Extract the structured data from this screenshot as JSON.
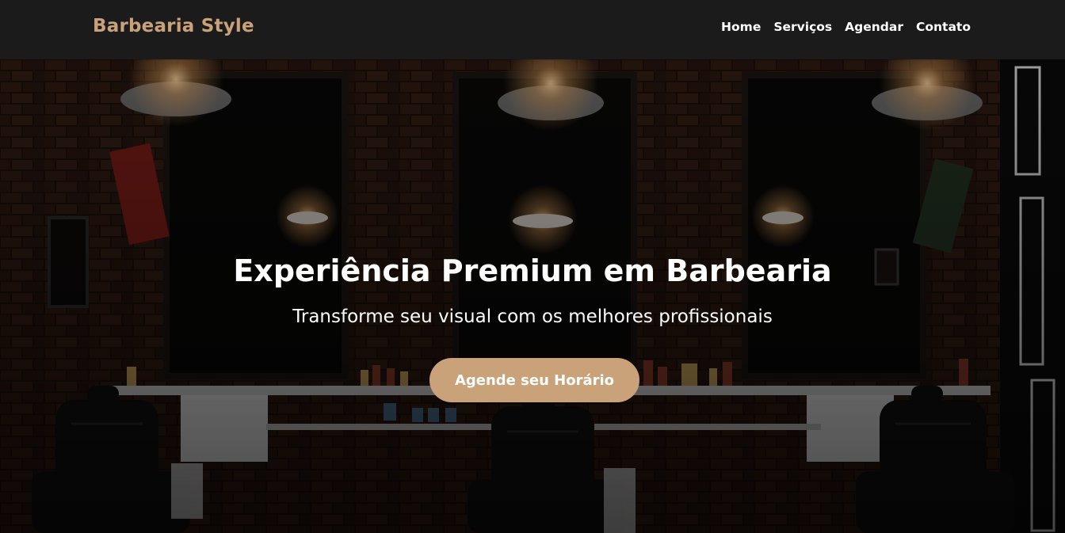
{
  "nav": {
    "brand": "Barbearia Style",
    "links": [
      {
        "label": "Home"
      },
      {
        "label": "Serviços"
      },
      {
        "label": "Agendar"
      },
      {
        "label": "Contato"
      }
    ]
  },
  "hero": {
    "title": "Experiência Premium em Barbearia",
    "subtitle": "Transforme seu visual com os melhores profissionais",
    "cta_label": "Agende seu Horário",
    "background_image": "barbershop-interior-photo"
  },
  "colors": {
    "accent": "#c9a27a",
    "navbar_bg": "#1b1b1b",
    "text": "#ffffff"
  }
}
